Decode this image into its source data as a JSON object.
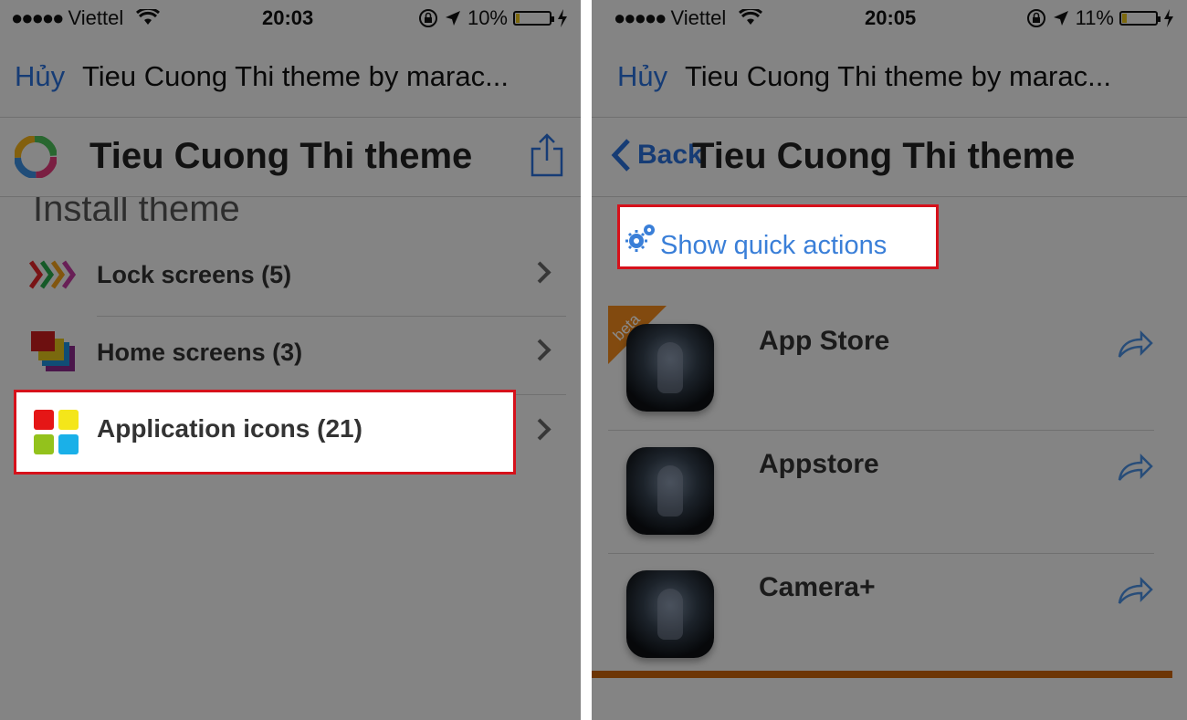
{
  "left": {
    "status": {
      "carrier": "Viettel",
      "time": "20:03",
      "battery": "10%",
      "battery_level": 0.1
    },
    "navbar": {
      "cancel": "Hủy",
      "title": "Tieu Cuong Thi theme by marac..."
    },
    "header": {
      "title": "Tieu Cuong Thi theme"
    },
    "section_title": "Install theme",
    "menu": [
      {
        "label": "Lock screens (5)",
        "icon": "chevrons-icon"
      },
      {
        "label": "Home screens (3)",
        "icon": "stacked-squares-icon"
      },
      {
        "label": "Application icons (21)",
        "icon": "four-squares-icon"
      }
    ]
  },
  "right": {
    "status": {
      "carrier": "Viettel",
      "time": "20:05",
      "battery": "11%",
      "battery_level": 0.11
    },
    "navbar": {
      "cancel": "Hủy",
      "title": "Tieu Cuong Thi theme by marac..."
    },
    "header": {
      "back": "Back",
      "title": "Tieu Cuong Thi theme"
    },
    "quick_actions": "Show quick actions",
    "beta": "beta",
    "apps": [
      {
        "name": "App Store"
      },
      {
        "name": "Appstore"
      },
      {
        "name": "Camera+"
      }
    ]
  },
  "colors": {
    "highlight_border": "#d6111b",
    "link_blue": "#2a6fd8",
    "beta_orange": "#f08a1c",
    "accent_bar": "#c9650c"
  }
}
